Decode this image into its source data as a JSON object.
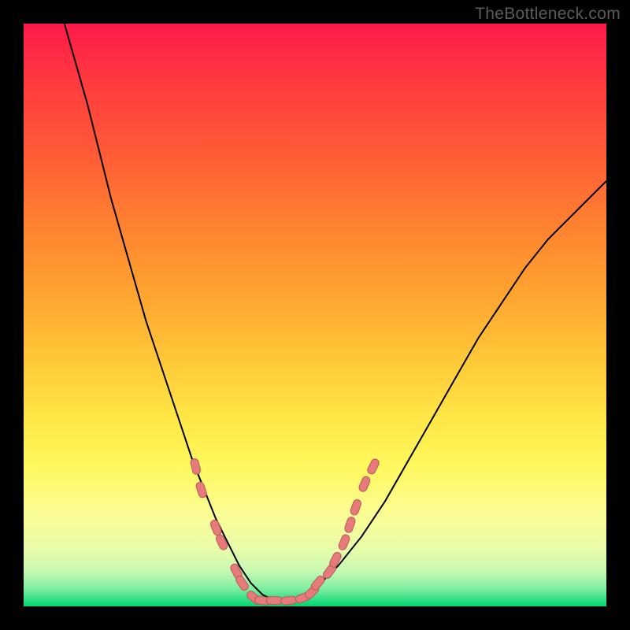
{
  "attribution": "TheBottleneck.com",
  "colors": {
    "black": "#000000",
    "stroke": "#000000",
    "marker": "#e77a7a",
    "marker_stroke": "#b85a5a"
  },
  "chart_data": {
    "type": "line",
    "title": "",
    "xlabel": "",
    "ylabel": "",
    "xlim": [
      0,
      100
    ],
    "ylim": [
      0,
      100
    ],
    "series": [
      {
        "name": "bottleneck-curve",
        "x": [
          7,
          9,
          11,
          13,
          15,
          17,
          19,
          21,
          23,
          25,
          27,
          29,
          31,
          33,
          35,
          37,
          39,
          41,
          43,
          46,
          50,
          54,
          58,
          62,
          66,
          70,
          74,
          78,
          82,
          86,
          90,
          94,
          98,
          100
        ],
        "y": [
          100,
          93,
          86,
          78,
          70,
          63,
          56,
          49,
          43,
          37,
          31,
          25,
          20,
          15,
          11,
          7,
          4,
          2,
          1,
          1,
          3,
          7,
          12,
          18,
          25,
          32,
          39,
          46,
          52,
          58,
          63,
          67,
          71,
          73
        ]
      }
    ],
    "markers": {
      "name": "highlight-segments",
      "note": "rounded-rect markers along curve near the minimum",
      "points": [
        {
          "x": 29.5,
          "y": 24
        },
        {
          "x": 30.5,
          "y": 20
        },
        {
          "x": 33.0,
          "y": 13.5
        },
        {
          "x": 34.0,
          "y": 11
        },
        {
          "x": 36.5,
          "y": 6
        },
        {
          "x": 37.5,
          "y": 4
        },
        {
          "x": 39.5,
          "y": 1.5
        },
        {
          "x": 41.0,
          "y": 1
        },
        {
          "x": 43.0,
          "y": 1
        },
        {
          "x": 45.5,
          "y": 1
        },
        {
          "x": 48.0,
          "y": 1.5
        },
        {
          "x": 49.5,
          "y": 2.5
        },
        {
          "x": 50.5,
          "y": 4
        },
        {
          "x": 52.5,
          "y": 6
        },
        {
          "x": 53.5,
          "y": 8
        },
        {
          "x": 55.0,
          "y": 11
        },
        {
          "x": 56.0,
          "y": 14
        },
        {
          "x": 57.0,
          "y": 17
        },
        {
          "x": 58.5,
          "y": 21
        },
        {
          "x": 60.0,
          "y": 24
        }
      ]
    }
  }
}
